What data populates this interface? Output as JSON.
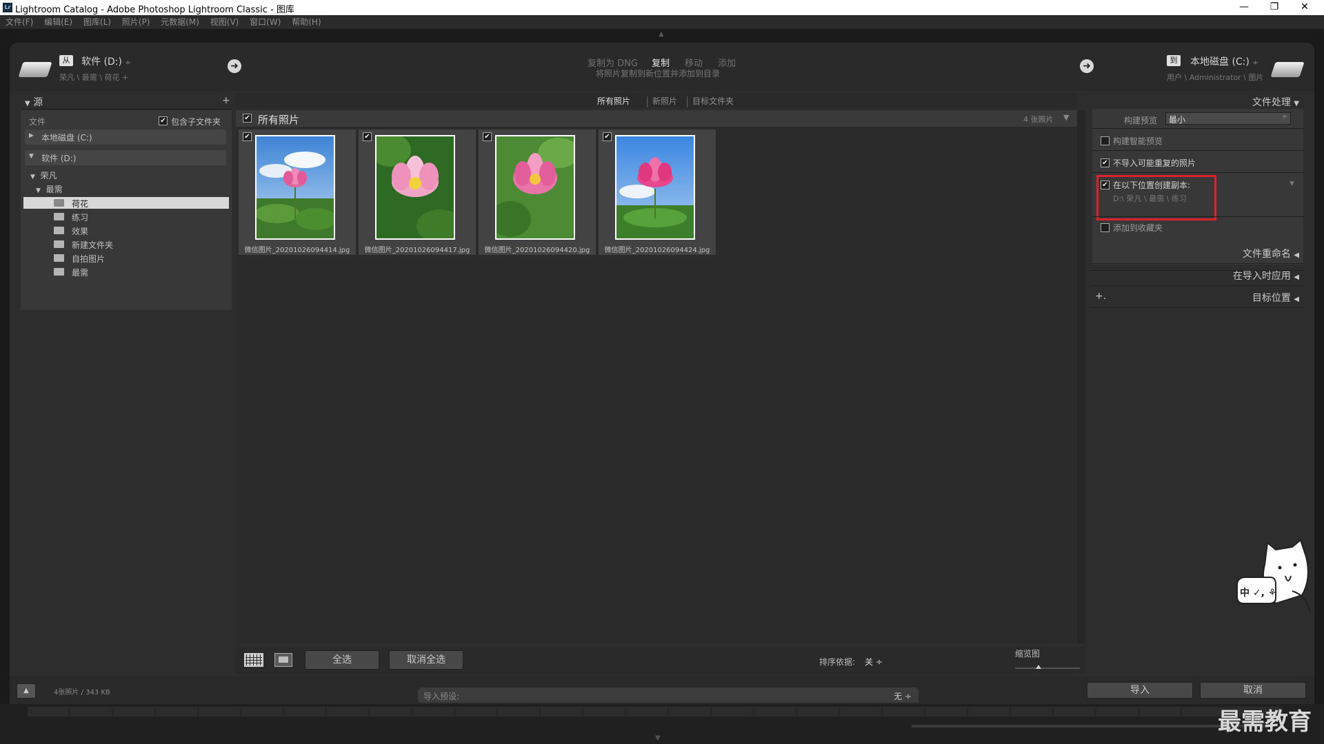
{
  "window": {
    "title": "Lightroom Catalog - Adobe Photoshop Lightroom Classic - 图库",
    "logo": "Lr"
  },
  "menu": [
    "文件(F)",
    "编辑(E)",
    "图库(L)",
    "照片(P)",
    "元数据(M)",
    "视图(V)",
    "窗口(W)",
    "帮助(H)"
  ],
  "source_disk": {
    "icon": "从",
    "name": "软件 (D:)",
    "path": "荣凡 \\ 最需 \\ 荷花 +"
  },
  "import_modes": {
    "dng": "复制为 DNG",
    "copy": "复制",
    "move": "移动",
    "add": "添加",
    "description": "将照片复制到新位置并添加到目录"
  },
  "dest_disk": {
    "icon": "到",
    "name": "本地磁盘 (C:)",
    "path": "用户 \\ Administrator \\ 图片"
  },
  "left_panel": {
    "header": "源",
    "files_label": "文件",
    "include_sub": "包含子文件夹",
    "drives": [
      "本地磁盘 (C:)",
      "软件 (D:)"
    ],
    "tree": {
      "level1": "荣凡",
      "level2": "最需",
      "folders": [
        "荷花",
        "练习",
        "效果",
        "新建文件夹",
        "自拍图片",
        "最需"
      ]
    }
  },
  "center": {
    "tabs": [
      "所有照片",
      "新照片",
      "目标文件夹"
    ],
    "header": "所有照片",
    "count": "4 张照片",
    "photos": [
      "微信图片_20201026094414.jpg",
      "微信图片_20201026094417.jpg",
      "微信图片_20201026094420.jpg",
      "微信图片_20201026094424.jpg"
    ],
    "select_all": "全选",
    "deselect_all": "取消全选",
    "sort_label": "排序依据:",
    "sort_value": "关 ÷",
    "thumb_label": "缩览图"
  },
  "right_panel": {
    "file_handling": "文件处理",
    "build_preview_label": "构建预览",
    "build_preview_value": "最小",
    "smart_preview": "构建智能预览",
    "no_duplicates": "不导入可能重复的照片",
    "make_copy": "在以下位置创建副本:",
    "copy_path": "D:\\ 荣凡 \\ 最需 \\ 练习",
    "add_to_collection": "添加到收藏夹",
    "file_rename": "文件重命名",
    "apply_during": "在导入时应用",
    "destination": "目标位置"
  },
  "bottom": {
    "photo_info": "4张照片 / 343 KB",
    "preset_label": "导入预设:",
    "preset_value": "无 ÷",
    "import_btn": "导入",
    "cancel_btn": "取消"
  },
  "watermark": "最需教育",
  "mascot_text": "中 ✓, ⚘"
}
